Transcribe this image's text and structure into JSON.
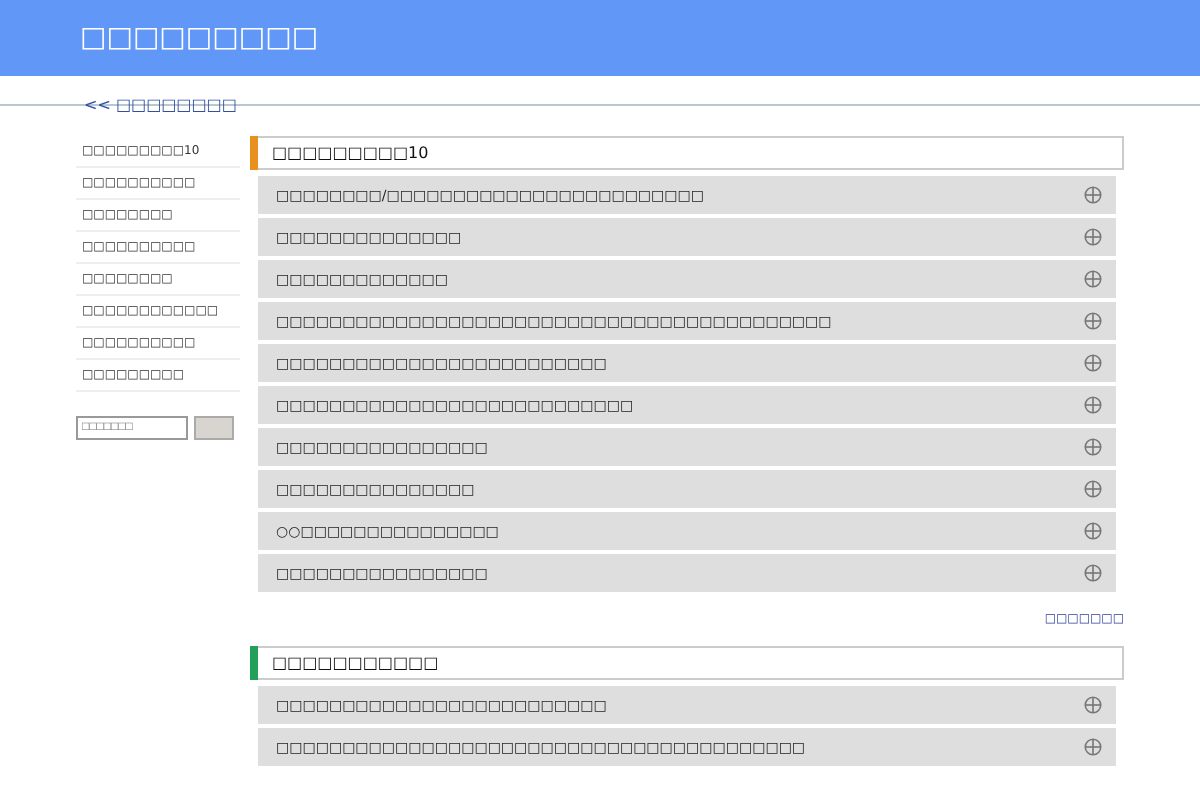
{
  "header": {
    "title": "□□□□□□□□□"
  },
  "breadcrumb": {
    "link": "<< □□□□□□□□"
  },
  "sidebar": {
    "items": [
      "□□□□□□□□□10",
      "□□□□□□□□□□",
      "□□□□□□□□",
      "□□□□□□□□□□",
      "□□□□□□□□",
      "□□□□□□□□□□□□",
      "□□□□□□□□□□",
      "□□□□□□□□□"
    ],
    "search": {
      "placeholder": "□□□□□□□"
    }
  },
  "sections": [
    {
      "title": "□□□□□□□□□10",
      "color": "#e8911e",
      "items": [
        {
          "label": "□□□□□□□□/□□□□□□□□□□□□□□□□□□□□□□□□",
          "expanded": false
        },
        {
          "label": "□□□□□□□□□□□□□□",
          "expanded": false
        },
        {
          "label": "□□□□□□□□□□□□□",
          "expanded": false
        },
        {
          "label": "□□□□□□□□□□□□□□□□□□□□□□□□□□□□□□□□□□□□□□□□□□",
          "expanded": false
        },
        {
          "label": "□□□□□□□□□□□□□□□□□□□□□□□□□",
          "expanded": false
        },
        {
          "label": "□□□□□□□□□□□□□□□□□□□□□□□□□□□",
          "expanded": false
        },
        {
          "label": "□□□□□□□□□□□□□□□□",
          "expanded": false
        },
        {
          "label": "□□□□□□□□□□□□□□□",
          "expanded": false
        },
        {
          "label": "○○□□□□□□□□□□□□□□□",
          "expanded": false
        },
        {
          "label": "□□□□□□□□□□□□□□□□",
          "expanded": false
        }
      ],
      "more": "□□□□□□□"
    },
    {
      "title": "□□□□□□□□□□□",
      "color": "#23a05a",
      "items": [
        {
          "label": "□□□□□□□□□□□□□□□□□□□□□□□□□",
          "expanded": false
        },
        {
          "label": "□□□□□□□□□□□□□□□□□□□□□□□□□□□□□□□□□□□□□□□□",
          "expanded": false
        }
      ]
    }
  ]
}
